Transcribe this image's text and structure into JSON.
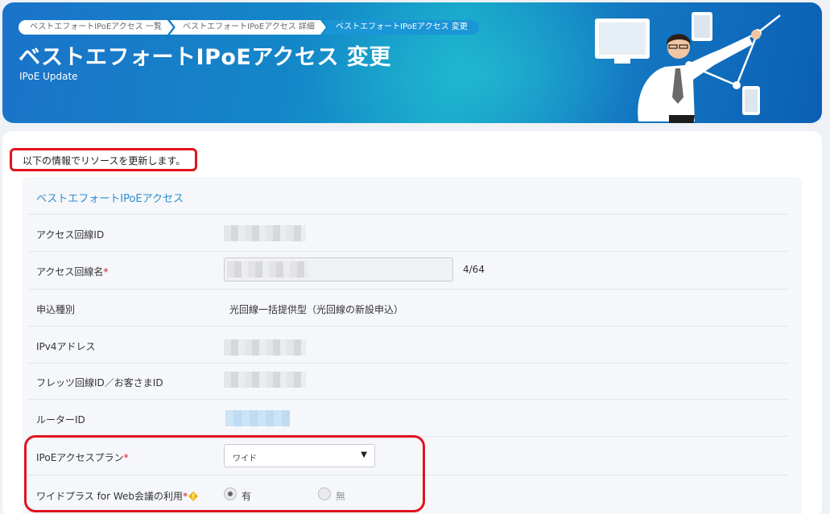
{
  "breadcrumb": {
    "items": [
      {
        "label": "ベストエフォートIPoEアクセス 一覧"
      },
      {
        "label": "ベストエフォートIPoEアクセス 詳細"
      },
      {
        "label": "ベストエフォートIPoEアクセス 変更"
      }
    ]
  },
  "header": {
    "title": "ベストエフォートIPoEアクセス 変更",
    "subtitle": "IPoE Update"
  },
  "main": {
    "intro": "以下の情報でリソースを更新します。",
    "section_title": "ベストエフォートIPoEアクセス",
    "fields": {
      "access_line_id": {
        "label": "アクセス回線ID"
      },
      "access_line_name": {
        "label": "アクセス回線名",
        "required_mark": "*",
        "char_count": "4/64"
      },
      "application_type": {
        "label": "申込種別",
        "value": "光回線一括提供型（光回線の新設申込）"
      },
      "ipv4": {
        "label": "IPv4アドレス"
      },
      "flets_id": {
        "label": "フレッツ回線ID／お客さまID"
      },
      "router_id": {
        "label": "ルーターID"
      },
      "plan": {
        "label": "IPoEアクセスプラン",
        "required_mark": "*",
        "selected": "ワイド"
      },
      "wide_plus": {
        "label": "ワイドプラス for Web会議の利用",
        "required_mark": "*",
        "options": [
          {
            "label": "有",
            "checked": true
          },
          {
            "label": "無",
            "checked": false,
            "disabled": true
          }
        ]
      }
    }
  },
  "colors": {
    "accent": "#1a95d6",
    "highlight": "#e0141e",
    "warning": "#f0b400"
  },
  "icons": {
    "warning": "warning-icon",
    "dropdown": "triangle-down-icon"
  }
}
